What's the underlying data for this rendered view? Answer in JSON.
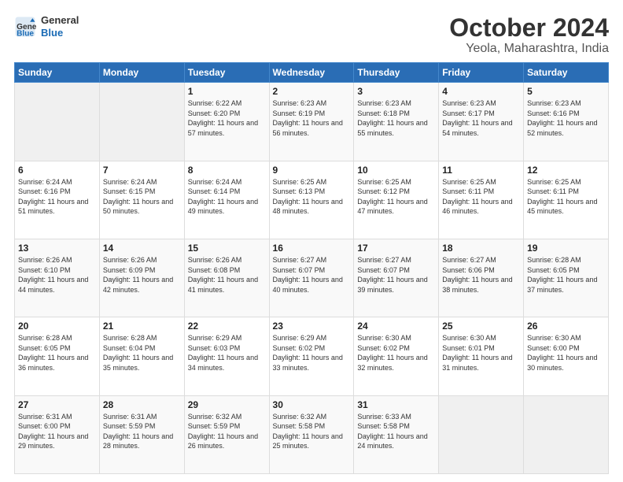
{
  "header": {
    "logo_general": "General",
    "logo_blue": "Blue",
    "title": "October 2024",
    "subtitle": "Yeola, Maharashtra, India"
  },
  "weekdays": [
    "Sunday",
    "Monday",
    "Tuesday",
    "Wednesday",
    "Thursday",
    "Friday",
    "Saturday"
  ],
  "rows": [
    [
      {
        "date": "",
        "info": ""
      },
      {
        "date": "",
        "info": ""
      },
      {
        "date": "1",
        "info": "Sunrise: 6:22 AM\nSunset: 6:20 PM\nDaylight: 11 hours and 57 minutes."
      },
      {
        "date": "2",
        "info": "Sunrise: 6:23 AM\nSunset: 6:19 PM\nDaylight: 11 hours and 56 minutes."
      },
      {
        "date": "3",
        "info": "Sunrise: 6:23 AM\nSunset: 6:18 PM\nDaylight: 11 hours and 55 minutes."
      },
      {
        "date": "4",
        "info": "Sunrise: 6:23 AM\nSunset: 6:17 PM\nDaylight: 11 hours and 54 minutes."
      },
      {
        "date": "5",
        "info": "Sunrise: 6:23 AM\nSunset: 6:16 PM\nDaylight: 11 hours and 52 minutes."
      }
    ],
    [
      {
        "date": "6",
        "info": "Sunrise: 6:24 AM\nSunset: 6:16 PM\nDaylight: 11 hours and 51 minutes."
      },
      {
        "date": "7",
        "info": "Sunrise: 6:24 AM\nSunset: 6:15 PM\nDaylight: 11 hours and 50 minutes."
      },
      {
        "date": "8",
        "info": "Sunrise: 6:24 AM\nSunset: 6:14 PM\nDaylight: 11 hours and 49 minutes."
      },
      {
        "date": "9",
        "info": "Sunrise: 6:25 AM\nSunset: 6:13 PM\nDaylight: 11 hours and 48 minutes."
      },
      {
        "date": "10",
        "info": "Sunrise: 6:25 AM\nSunset: 6:12 PM\nDaylight: 11 hours and 47 minutes."
      },
      {
        "date": "11",
        "info": "Sunrise: 6:25 AM\nSunset: 6:11 PM\nDaylight: 11 hours and 46 minutes."
      },
      {
        "date": "12",
        "info": "Sunrise: 6:25 AM\nSunset: 6:11 PM\nDaylight: 11 hours and 45 minutes."
      }
    ],
    [
      {
        "date": "13",
        "info": "Sunrise: 6:26 AM\nSunset: 6:10 PM\nDaylight: 11 hours and 44 minutes."
      },
      {
        "date": "14",
        "info": "Sunrise: 6:26 AM\nSunset: 6:09 PM\nDaylight: 11 hours and 42 minutes."
      },
      {
        "date": "15",
        "info": "Sunrise: 6:26 AM\nSunset: 6:08 PM\nDaylight: 11 hours and 41 minutes."
      },
      {
        "date": "16",
        "info": "Sunrise: 6:27 AM\nSunset: 6:07 PM\nDaylight: 11 hours and 40 minutes."
      },
      {
        "date": "17",
        "info": "Sunrise: 6:27 AM\nSunset: 6:07 PM\nDaylight: 11 hours and 39 minutes."
      },
      {
        "date": "18",
        "info": "Sunrise: 6:27 AM\nSunset: 6:06 PM\nDaylight: 11 hours and 38 minutes."
      },
      {
        "date": "19",
        "info": "Sunrise: 6:28 AM\nSunset: 6:05 PM\nDaylight: 11 hours and 37 minutes."
      }
    ],
    [
      {
        "date": "20",
        "info": "Sunrise: 6:28 AM\nSunset: 6:05 PM\nDaylight: 11 hours and 36 minutes."
      },
      {
        "date": "21",
        "info": "Sunrise: 6:28 AM\nSunset: 6:04 PM\nDaylight: 11 hours and 35 minutes."
      },
      {
        "date": "22",
        "info": "Sunrise: 6:29 AM\nSunset: 6:03 PM\nDaylight: 11 hours and 34 minutes."
      },
      {
        "date": "23",
        "info": "Sunrise: 6:29 AM\nSunset: 6:02 PM\nDaylight: 11 hours and 33 minutes."
      },
      {
        "date": "24",
        "info": "Sunrise: 6:30 AM\nSunset: 6:02 PM\nDaylight: 11 hours and 32 minutes."
      },
      {
        "date": "25",
        "info": "Sunrise: 6:30 AM\nSunset: 6:01 PM\nDaylight: 11 hours and 31 minutes."
      },
      {
        "date": "26",
        "info": "Sunrise: 6:30 AM\nSunset: 6:00 PM\nDaylight: 11 hours and 30 minutes."
      }
    ],
    [
      {
        "date": "27",
        "info": "Sunrise: 6:31 AM\nSunset: 6:00 PM\nDaylight: 11 hours and 29 minutes."
      },
      {
        "date": "28",
        "info": "Sunrise: 6:31 AM\nSunset: 5:59 PM\nDaylight: 11 hours and 28 minutes."
      },
      {
        "date": "29",
        "info": "Sunrise: 6:32 AM\nSunset: 5:59 PM\nDaylight: 11 hours and 26 minutes."
      },
      {
        "date": "30",
        "info": "Sunrise: 6:32 AM\nSunset: 5:58 PM\nDaylight: 11 hours and 25 minutes."
      },
      {
        "date": "31",
        "info": "Sunrise: 6:33 AM\nSunset: 5:58 PM\nDaylight: 11 hours and 24 minutes."
      },
      {
        "date": "",
        "info": ""
      },
      {
        "date": "",
        "info": ""
      }
    ]
  ]
}
